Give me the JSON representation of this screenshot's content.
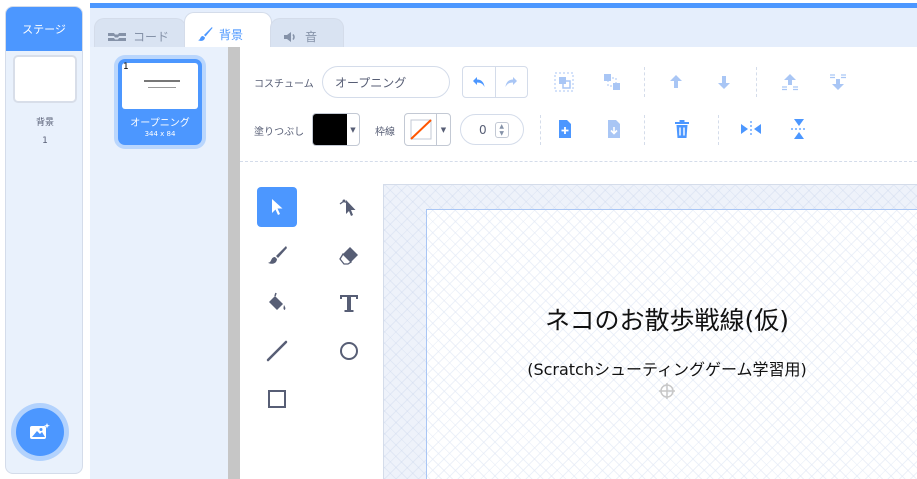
{
  "stage": {
    "header": "ステージ",
    "backdrop_label": "背景",
    "backdrop_count": "1"
  },
  "tabs": [
    {
      "label": "コード",
      "icon": "code-blocks-icon"
    },
    {
      "label": "背景",
      "icon": "paintbrush-icon"
    },
    {
      "label": "音",
      "icon": "speaker-icon"
    }
  ],
  "active_tab": "背景",
  "costume_list": [
    {
      "number": "1",
      "name": "オープニング",
      "size": "344 x 84"
    }
  ],
  "toolbar": {
    "costume_label": "コスチューム",
    "costume_name": "オープニング",
    "fill_label": "塗りつぶし",
    "fill_color": "#000000",
    "outline_label": "枠線",
    "outline_color": "none",
    "stroke_width": "0"
  },
  "tools": [
    "select-tool",
    "reshape-tool",
    "brush-tool",
    "eraser-tool",
    "fill-tool",
    "text-tool",
    "line-tool",
    "circle-tool",
    "rectangle-tool"
  ],
  "canvas": {
    "title": "ネコのお散歩戦線(仮)",
    "subtitle": "(Scratchシューティングゲーム学習用)"
  },
  "colors": {
    "accent": "#4c97ff",
    "panel_bg": "#e9f1fc",
    "text": "#575e75"
  }
}
